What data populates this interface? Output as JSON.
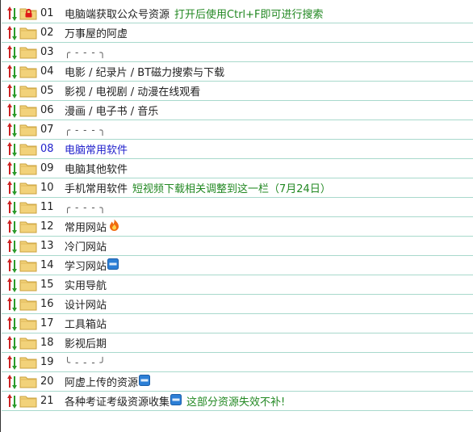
{
  "colors": {
    "row_divider": "#a8d9cc",
    "note_green": "#228822",
    "selected_blue": "#2222cc",
    "sort_up_red": "#cc2222",
    "sort_down_green": "#2a9a2a",
    "folder_yellow": "#f2d27a"
  },
  "rows": [
    {
      "num": "01",
      "label": "电脑端获取公众号资源",
      "note": "打开后使用Ctrl+F即可进行搜索",
      "icon": "folder-locked-icon"
    },
    {
      "num": "02",
      "label": "万事屋的阿虚",
      "note": "",
      "icon": "folder-icon"
    },
    {
      "num": "03",
      "label": "╭ - - - ╮",
      "note": "",
      "icon": "folder-icon"
    },
    {
      "num": "04",
      "label": "电影 / 纪录片 / BT磁力搜索与下载",
      "note": "",
      "icon": "folder-icon"
    },
    {
      "num": "05",
      "label": "影视 / 电视剧 / 动漫在线观看",
      "note": "",
      "icon": "folder-icon"
    },
    {
      "num": "06",
      "label": "漫画 / 电子书 / 音乐",
      "note": "",
      "icon": "folder-icon"
    },
    {
      "num": "07",
      "label": "╭ - - - ╮",
      "note": "",
      "icon": "folder-icon"
    },
    {
      "num": "08",
      "label": "电脑常用软件",
      "note": "",
      "icon": "folder-icon",
      "selected": true
    },
    {
      "num": "09",
      "label": "电脑其他软件",
      "note": "",
      "icon": "folder-icon"
    },
    {
      "num": "10",
      "label": "手机常用软件",
      "note": "短视频下载相关调整到这一栏（7月24日）",
      "icon": "folder-icon"
    },
    {
      "num": "11",
      "label": "╭ - - - ╮",
      "note": "",
      "icon": "folder-icon"
    },
    {
      "num": "12",
      "label": "常用网站",
      "note": "",
      "icon": "folder-icon",
      "badge": "fire-icon"
    },
    {
      "num": "13",
      "label": "冷门网站",
      "note": "",
      "icon": "folder-icon"
    },
    {
      "num": "14",
      "label": "学习网站",
      "note": "",
      "icon": "folder-icon",
      "badge": "new-icon"
    },
    {
      "num": "15",
      "label": "实用导航",
      "note": "",
      "icon": "folder-icon"
    },
    {
      "num": "16",
      "label": "设计网站",
      "note": "",
      "icon": "folder-icon"
    },
    {
      "num": "17",
      "label": "工具箱站",
      "note": "",
      "icon": "folder-icon"
    },
    {
      "num": "18",
      "label": "影视后期",
      "note": "",
      "icon": "folder-icon"
    },
    {
      "num": "19",
      "label": "╰ - - - ╯",
      "note": "",
      "icon": "folder-icon"
    },
    {
      "num": "20",
      "label": "阿虚上传的资源",
      "note": "",
      "icon": "folder-icon",
      "badge": "new-icon"
    },
    {
      "num": "21",
      "label": "各种考证考级资源收集",
      "note": "这部分资源失效不补!",
      "icon": "folder-icon",
      "badge": "new-icon"
    }
  ]
}
